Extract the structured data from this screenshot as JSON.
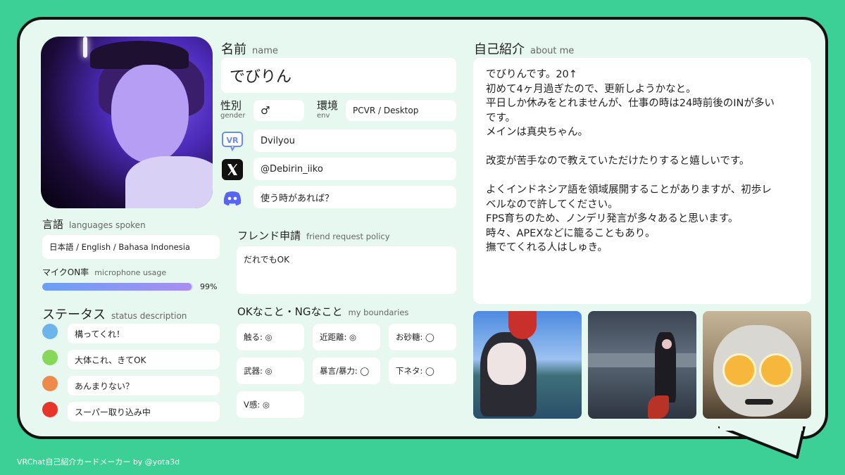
{
  "name_section": {
    "title": "名前",
    "sub": "name",
    "value": "でびりん"
  },
  "gender": {
    "label": "性別",
    "sub": "gender",
    "value": "♂"
  },
  "env": {
    "label": "環境",
    "sub": "env",
    "value": "PCVR / Desktop"
  },
  "sns": [
    {
      "icon": "vrchat-icon",
      "value": "Dvilyou"
    },
    {
      "icon": "x-icon",
      "value": "@Debirin_iiko"
    },
    {
      "icon": "discord-icon",
      "value": "使う時があれば？"
    }
  ],
  "languages": {
    "title": "言語",
    "sub": "languages spoken",
    "value": "日本語 / English / Bahasa Indonesia"
  },
  "mic": {
    "title": "マイクON率",
    "sub": "microphone usage",
    "percent_label": "99%",
    "fraction": 0.99
  },
  "status": {
    "title": "ステータス",
    "sub": "status description",
    "items": [
      {
        "color": "#6cb4ea",
        "text": "構ってくれ！"
      },
      {
        "color": "#85d85a",
        "text": "大体これ、きてOK"
      },
      {
        "color": "#f08a4b",
        "text": "あんまりない？"
      },
      {
        "color": "#e8352a",
        "text": "スーパー取り込み中"
      }
    ]
  },
  "friend": {
    "title": "フレンド申請",
    "sub": "friend request policy",
    "value": "だれでもOK"
  },
  "boundaries": {
    "title": "OKなこと・NGなこと",
    "sub": "my boundaries",
    "items": [
      "触る: ◎",
      "近距離: ◎",
      "お砂糖: ◯",
      "武器: ◎",
      "暴言/暴力: ◯",
      "下ネタ: ◯",
      "V感: ◎"
    ]
  },
  "about": {
    "title": "自己紹介",
    "sub": "about me",
    "lines": [
      "でびりんです。20↑",
      "初めて4ヶ月過ぎたので、更新しようかなと。",
      "平日しか休みをとれませんが、仕事の時は24時前後のINが多い",
      "です。",
      "メインは真央ちゃん。",
      "",
      "改変が苦手なので教えていただけたりすると嬉しいです。",
      "",
      "よくインドネシア語を領域展開することがありますが、初歩レ",
      "ベルなので許してください。",
      "FPS育ちのため、ノンデリ発言が多々あると思います。",
      "時々、APEXなどに籠ることもあり。",
      "撫でてくれる人はしゅき。"
    ]
  },
  "footer": "VRChat自己紹介カードメーカー by @yota3d",
  "colors": {
    "accent": "#3ccf96",
    "card": "#e7f8f0"
  }
}
